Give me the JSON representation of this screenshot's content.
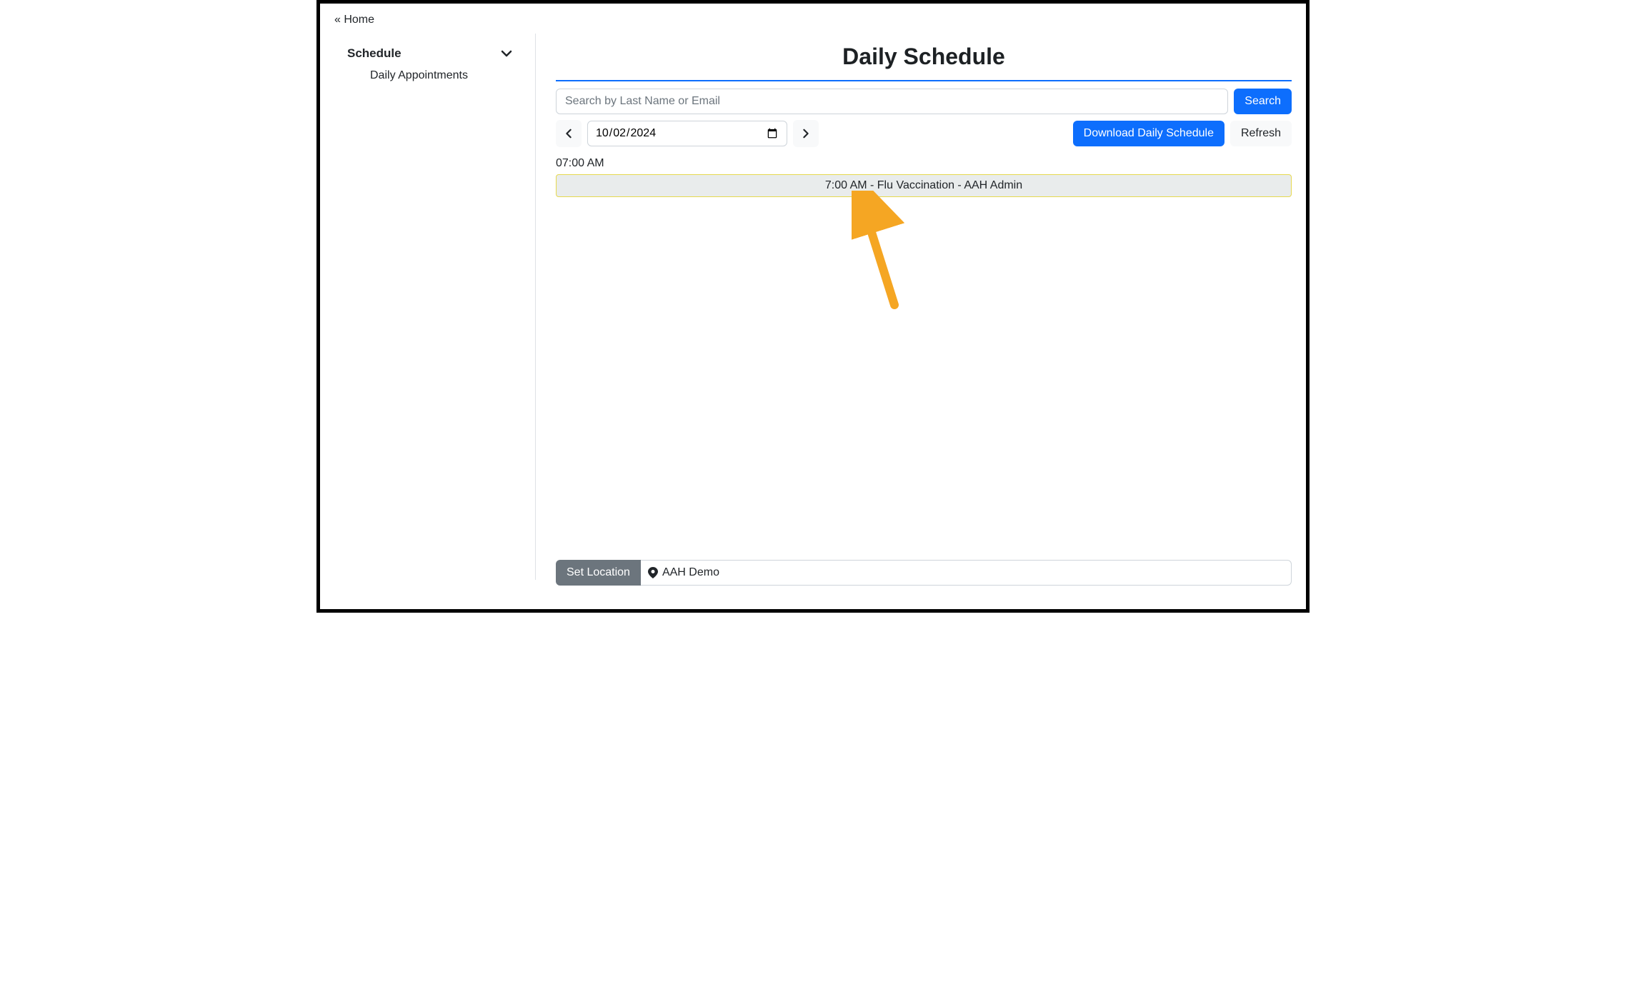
{
  "breadcrumb": {
    "home": "« Home"
  },
  "sidebar": {
    "header": "Schedule",
    "items": [
      {
        "label": "Daily Appointments"
      }
    ]
  },
  "page": {
    "title": "Daily Schedule"
  },
  "search": {
    "placeholder": "Search by Last Name or Email",
    "button": "Search"
  },
  "dateNav": {
    "value": "2024-10-02",
    "download": "Download Daily Schedule",
    "refresh": "Refresh"
  },
  "schedule": {
    "slots": [
      {
        "time_label": "07:00 AM",
        "appointment": "7:00 AM - Flu Vaccination - AAH Admin"
      }
    ]
  },
  "location": {
    "set_button": "Set Location",
    "value": "AAH Demo"
  }
}
